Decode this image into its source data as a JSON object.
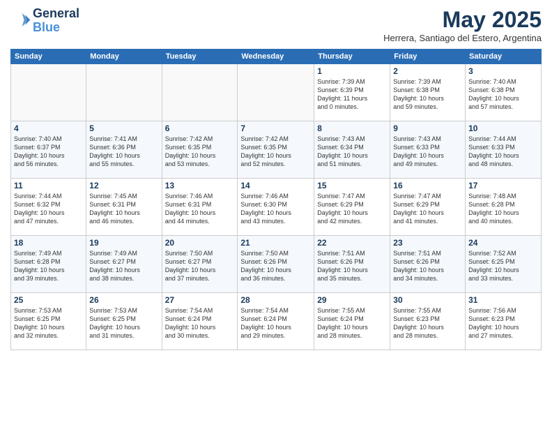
{
  "header": {
    "logo_line1": "General",
    "logo_line2": "Blue",
    "month_title": "May 2025",
    "location": "Herrera, Santiago del Estero, Argentina"
  },
  "days_of_week": [
    "Sunday",
    "Monday",
    "Tuesday",
    "Wednesday",
    "Thursday",
    "Friday",
    "Saturday"
  ],
  "weeks": [
    [
      {
        "day": "",
        "info": ""
      },
      {
        "day": "",
        "info": ""
      },
      {
        "day": "",
        "info": ""
      },
      {
        "day": "",
        "info": ""
      },
      {
        "day": "1",
        "info": "Sunrise: 7:39 AM\nSunset: 6:39 PM\nDaylight: 11 hours\nand 0 minutes."
      },
      {
        "day": "2",
        "info": "Sunrise: 7:39 AM\nSunset: 6:38 PM\nDaylight: 10 hours\nand 59 minutes."
      },
      {
        "day": "3",
        "info": "Sunrise: 7:40 AM\nSunset: 6:38 PM\nDaylight: 10 hours\nand 57 minutes."
      }
    ],
    [
      {
        "day": "4",
        "info": "Sunrise: 7:40 AM\nSunset: 6:37 PM\nDaylight: 10 hours\nand 56 minutes."
      },
      {
        "day": "5",
        "info": "Sunrise: 7:41 AM\nSunset: 6:36 PM\nDaylight: 10 hours\nand 55 minutes."
      },
      {
        "day": "6",
        "info": "Sunrise: 7:42 AM\nSunset: 6:35 PM\nDaylight: 10 hours\nand 53 minutes."
      },
      {
        "day": "7",
        "info": "Sunrise: 7:42 AM\nSunset: 6:35 PM\nDaylight: 10 hours\nand 52 minutes."
      },
      {
        "day": "8",
        "info": "Sunrise: 7:43 AM\nSunset: 6:34 PM\nDaylight: 10 hours\nand 51 minutes."
      },
      {
        "day": "9",
        "info": "Sunrise: 7:43 AM\nSunset: 6:33 PM\nDaylight: 10 hours\nand 49 minutes."
      },
      {
        "day": "10",
        "info": "Sunrise: 7:44 AM\nSunset: 6:33 PM\nDaylight: 10 hours\nand 48 minutes."
      }
    ],
    [
      {
        "day": "11",
        "info": "Sunrise: 7:44 AM\nSunset: 6:32 PM\nDaylight: 10 hours\nand 47 minutes."
      },
      {
        "day": "12",
        "info": "Sunrise: 7:45 AM\nSunset: 6:31 PM\nDaylight: 10 hours\nand 46 minutes."
      },
      {
        "day": "13",
        "info": "Sunrise: 7:46 AM\nSunset: 6:31 PM\nDaylight: 10 hours\nand 44 minutes."
      },
      {
        "day": "14",
        "info": "Sunrise: 7:46 AM\nSunset: 6:30 PM\nDaylight: 10 hours\nand 43 minutes."
      },
      {
        "day": "15",
        "info": "Sunrise: 7:47 AM\nSunset: 6:29 PM\nDaylight: 10 hours\nand 42 minutes."
      },
      {
        "day": "16",
        "info": "Sunrise: 7:47 AM\nSunset: 6:29 PM\nDaylight: 10 hours\nand 41 minutes."
      },
      {
        "day": "17",
        "info": "Sunrise: 7:48 AM\nSunset: 6:28 PM\nDaylight: 10 hours\nand 40 minutes."
      }
    ],
    [
      {
        "day": "18",
        "info": "Sunrise: 7:49 AM\nSunset: 6:28 PM\nDaylight: 10 hours\nand 39 minutes."
      },
      {
        "day": "19",
        "info": "Sunrise: 7:49 AM\nSunset: 6:27 PM\nDaylight: 10 hours\nand 38 minutes."
      },
      {
        "day": "20",
        "info": "Sunrise: 7:50 AM\nSunset: 6:27 PM\nDaylight: 10 hours\nand 37 minutes."
      },
      {
        "day": "21",
        "info": "Sunrise: 7:50 AM\nSunset: 6:26 PM\nDaylight: 10 hours\nand 36 minutes."
      },
      {
        "day": "22",
        "info": "Sunrise: 7:51 AM\nSunset: 6:26 PM\nDaylight: 10 hours\nand 35 minutes."
      },
      {
        "day": "23",
        "info": "Sunrise: 7:51 AM\nSunset: 6:26 PM\nDaylight: 10 hours\nand 34 minutes."
      },
      {
        "day": "24",
        "info": "Sunrise: 7:52 AM\nSunset: 6:25 PM\nDaylight: 10 hours\nand 33 minutes."
      }
    ],
    [
      {
        "day": "25",
        "info": "Sunrise: 7:53 AM\nSunset: 6:25 PM\nDaylight: 10 hours\nand 32 minutes."
      },
      {
        "day": "26",
        "info": "Sunrise: 7:53 AM\nSunset: 6:25 PM\nDaylight: 10 hours\nand 31 minutes."
      },
      {
        "day": "27",
        "info": "Sunrise: 7:54 AM\nSunset: 6:24 PM\nDaylight: 10 hours\nand 30 minutes."
      },
      {
        "day": "28",
        "info": "Sunrise: 7:54 AM\nSunset: 6:24 PM\nDaylight: 10 hours\nand 29 minutes."
      },
      {
        "day": "29",
        "info": "Sunrise: 7:55 AM\nSunset: 6:24 PM\nDaylight: 10 hours\nand 28 minutes."
      },
      {
        "day": "30",
        "info": "Sunrise: 7:55 AM\nSunset: 6:23 PM\nDaylight: 10 hours\nand 28 minutes."
      },
      {
        "day": "31",
        "info": "Sunrise: 7:56 AM\nSunset: 6:23 PM\nDaylight: 10 hours\nand 27 minutes."
      }
    ]
  ]
}
